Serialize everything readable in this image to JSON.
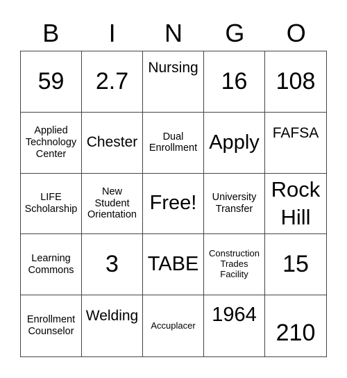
{
  "header": [
    "B",
    "I",
    "N",
    "G",
    "O"
  ],
  "cells": [
    "59",
    "2.7",
    "Nursing",
    "16",
    "108",
    "Applied Technology Center",
    "Chester",
    "Dual Enrollment",
    "Apply",
    "FAFSA",
    "LIFE Scholarship",
    "New Student Orientation",
    "Free!",
    "University Transfer",
    "Rock Hill",
    "Learning Commons",
    "3",
    "TABE",
    "Construction Trades Facility",
    "15",
    "Enrollment Counselor",
    "Welding",
    "Accuplacer",
    "1964",
    "210"
  ]
}
